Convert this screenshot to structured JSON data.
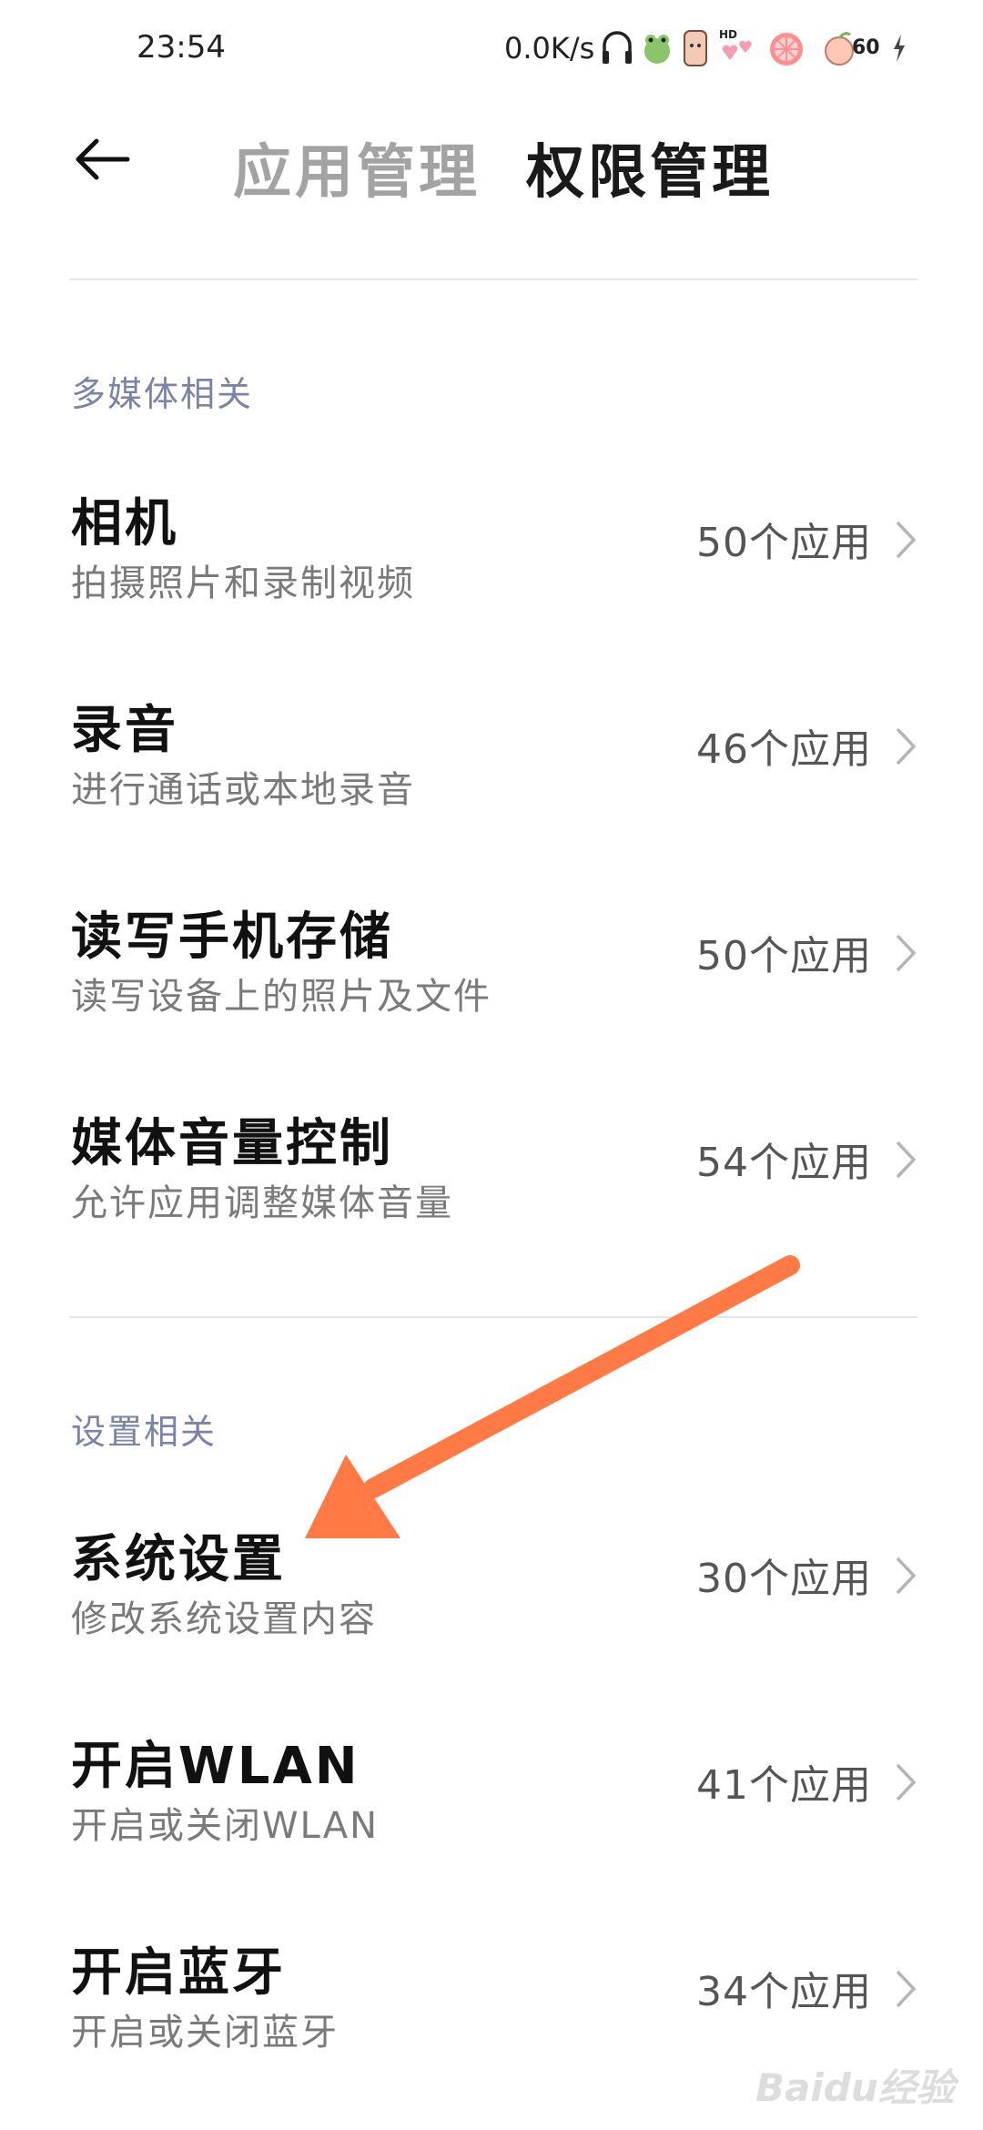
{
  "status_bar": {
    "time": "23:54",
    "net_speed": "0.0K/s",
    "battery": "60",
    "icons": [
      "headphones-icon",
      "frog-sticker-icon",
      "phone-sticker-icon",
      "hd-hearts-icon",
      "grapefruit-icon",
      "peach-icon",
      "charging-icon"
    ]
  },
  "header": {
    "tab_apps": "应用管理",
    "tab_permissions": "权限管理"
  },
  "sections": [
    {
      "title": "多媒体相关",
      "items": [
        {
          "title": "相机",
          "subtitle": "拍摄照片和录制视频",
          "count": "50个应用"
        },
        {
          "title": "录音",
          "subtitle": "进行通话或本地录音",
          "count": "46个应用"
        },
        {
          "title": "读写手机存储",
          "subtitle": "读写设备上的照片及文件",
          "count": "50个应用"
        },
        {
          "title": "媒体音量控制",
          "subtitle": "允许应用调整媒体音量",
          "count": "54个应用"
        }
      ]
    },
    {
      "title": "设置相关",
      "items": [
        {
          "title": "系统设置",
          "subtitle": "修改系统设置内容",
          "count": "30个应用"
        },
        {
          "title": "开启WLAN",
          "subtitle": "开启或关闭WLAN",
          "count": "41个应用"
        },
        {
          "title": "开启蓝牙",
          "subtitle": "开启或关闭蓝牙",
          "count": "34个应用"
        }
      ]
    }
  ],
  "annotation": {
    "arrow_color": "#ff7a45"
  },
  "watermark": "Baidu经验"
}
